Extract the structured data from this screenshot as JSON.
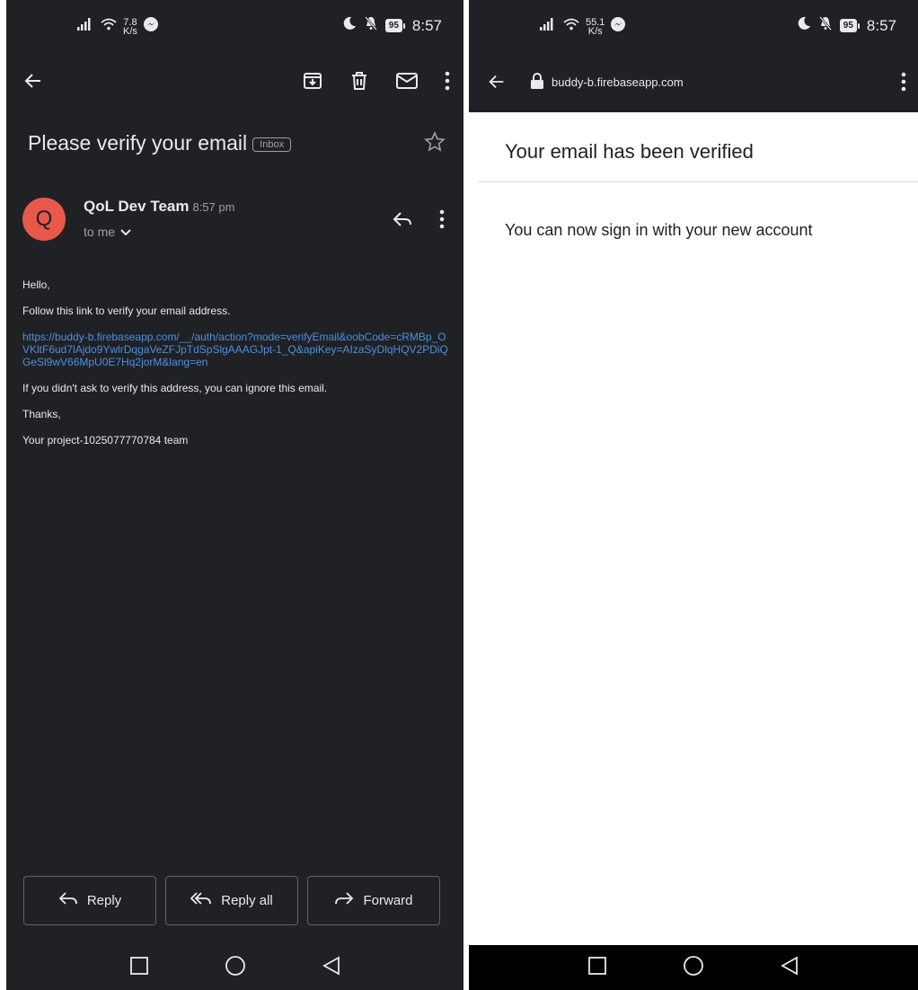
{
  "left": {
    "status": {
      "speed_value": "7.8",
      "speed_unit": "K/s",
      "battery": "95",
      "time": "8:57"
    },
    "subject": "Please verify your email",
    "label_chip": "Inbox",
    "sender": {
      "avatar_letter": "Q",
      "name": "QoL Dev Team",
      "time": "8:57 pm",
      "recipient": "to me"
    },
    "body": {
      "greeting": "Hello,",
      "instruction": "Follow this link to verify your email address.",
      "link": "https://buddy-b.firebaseapp.com/__/auth/action?mode=verifyEmail&oobCode=cRMBp_OVKltF6ud7lAjdo9YwlrDqgaVeZFJpTdSpSlgAAAGJpt-1_Q&apiKey=AIzaSyDlqHQV2PDiQGeSl9wV66MpU0E7Hq2jorM&lang=en",
      "ignore_note": "If you didn't ask to verify this address, you can ignore this email.",
      "thanks": "Thanks,",
      "signature": "Your project-1025077770784 team"
    },
    "actions": {
      "reply": "Reply",
      "reply_all": "Reply all",
      "forward": "Forward"
    }
  },
  "right": {
    "status": {
      "speed_value": "55.1",
      "speed_unit": "K/s",
      "battery": "95",
      "time": "8:57"
    },
    "url": "buddy-b.firebaseapp.com",
    "title": "Your email has been verified",
    "message": "You can now sign in with your new account"
  },
  "colors": {
    "dark_bg": "#202124",
    "link": "#4a90e2",
    "avatar": "#e8594b"
  }
}
